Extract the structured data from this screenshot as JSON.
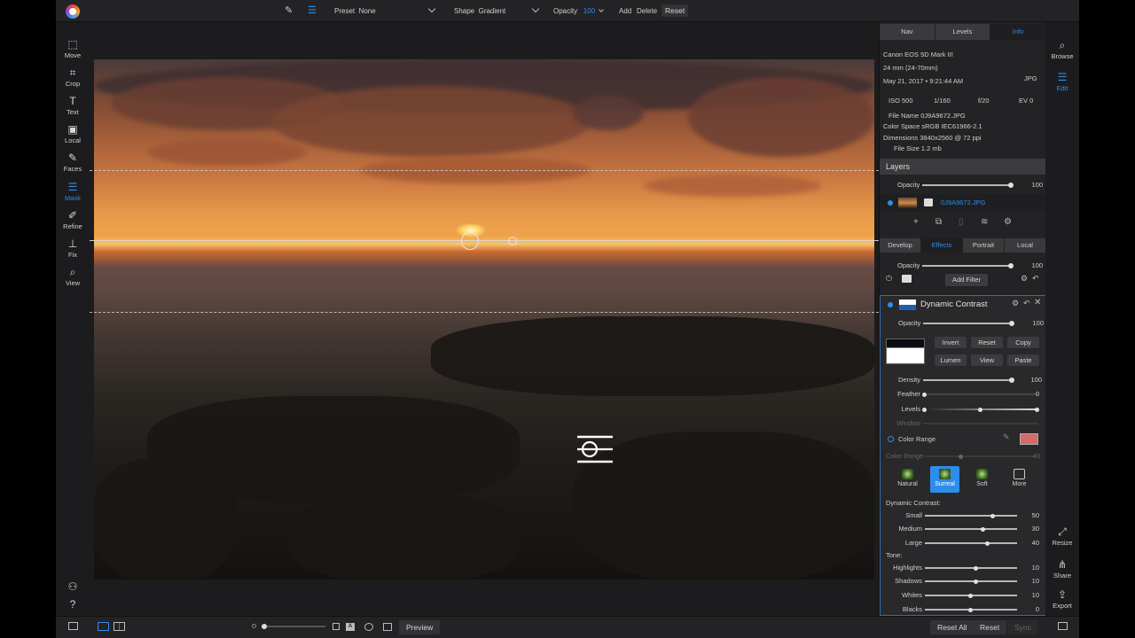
{
  "toolbar": {
    "preset_label": "Preset",
    "preset_value": "None",
    "shape_label": "Shape",
    "shape_value": "Gradient",
    "opacity_label": "Opacity",
    "opacity_value": "100",
    "add": "Add",
    "delete": "Delete",
    "reset": "Reset"
  },
  "tools": [
    {
      "label": "Move",
      "icon": "move-icon"
    },
    {
      "label": "Crop",
      "icon": "crop-icon"
    },
    {
      "label": "Text",
      "icon": "text-icon"
    },
    {
      "label": "Local",
      "icon": "local-icon"
    },
    {
      "label": "Faces",
      "icon": "faces-icon"
    },
    {
      "label": "Mask",
      "icon": "mask-icon"
    },
    {
      "label": "Refine",
      "icon": "refine-icon"
    },
    {
      "label": "Fix",
      "icon": "fix-icon"
    },
    {
      "label": "View",
      "icon": "view-icon"
    }
  ],
  "right_rail": {
    "browse": "Browse",
    "edit": "Edit",
    "resize": "Resize",
    "share": "Share",
    "export": "Export"
  },
  "panel_tabs": [
    "Nav",
    "Levels",
    "Info"
  ],
  "info": {
    "camera": "Canon EOS 5D Mark III",
    "lens": "24 mm (24-70mm)",
    "date": "May 21, 2017 • 9:21:44 AM",
    "format": "JPG",
    "iso": "ISO 500",
    "shutter": "1/160",
    "aperture": "f/20",
    "ev": "EV 0",
    "file_name": "File Name 0J9A9672.JPG",
    "color_space": "Color Space sRGB IEC61966-2.1",
    "dimensions": "Dimensions 3840x2560 @ 72 ppi",
    "file_size": "File Size 1.2 mb"
  },
  "layers": {
    "title": "Layers",
    "opacity_label": "Opacity",
    "opacity_value": "100",
    "layer_name": "0J9A9672.JPG"
  },
  "module_tabs": [
    "Develop",
    "Effects",
    "Portrait",
    "Local"
  ],
  "effects": {
    "opacity_label": "Opacity",
    "opacity_value": "100",
    "add_filter": "Add Filter"
  },
  "filter": {
    "name": "Dynamic Contrast",
    "opacity_label": "Opacity",
    "opacity_value": "100",
    "buttons": [
      "Invert",
      "Reset",
      "Copy",
      "Lumen",
      "View",
      "Paste"
    ],
    "density_label": "Density",
    "density_value": "100",
    "feather_label": "Feather",
    "feather_value": "0",
    "levels_label": "Levels",
    "window_label": "Window",
    "color_range_toggle": "Color Range",
    "color_range_label": "Color Range",
    "color_range_value": "40",
    "swatch_color": "#d46a6a",
    "presets": [
      "Natural",
      "Surreal",
      "Soft",
      "More"
    ],
    "dynamic_contrast_heading": "Dynamic Contrast:",
    "small_label": "Small",
    "small_value": "50",
    "medium_label": "Medium",
    "medium_value": "30",
    "large_label": "Large",
    "large_value": "40",
    "tone_heading": "Tone:",
    "highlights_label": "Highlights",
    "highlights_value": "10",
    "shadows_label": "Shadows",
    "shadows_value": "10",
    "whites_label": "Whites",
    "whites_value": "10",
    "blacks_label": "Blacks",
    "blacks_value": "0"
  },
  "bottom": {
    "preview": "Preview",
    "reset_all": "Reset All",
    "reset": "Reset",
    "sync": "Sync"
  },
  "colors": {
    "accent": "#2f8dea"
  }
}
